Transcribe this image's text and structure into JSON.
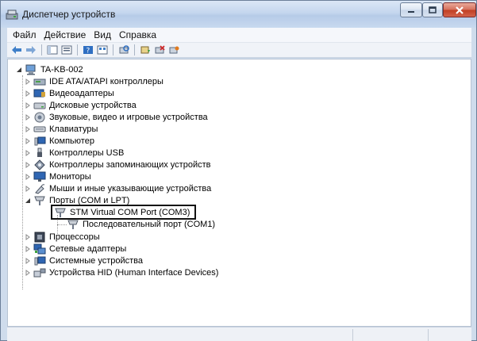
{
  "window": {
    "title": "Диспетчер устройств"
  },
  "menu": {
    "items": [
      "Файл",
      "Действие",
      "Вид",
      "Справка"
    ]
  },
  "toolbar": {
    "icons": [
      "back-icon",
      "forward-icon",
      "show-hide-console-tree-icon",
      "properties-icon",
      "help-icon",
      "view-icon",
      "scan-hardware-icon",
      "update-driver-icon",
      "disable-device-icon",
      "uninstall-device-icon"
    ]
  },
  "tree": {
    "root": "TA-KB-002",
    "categories": [
      {
        "label": "IDE ATA/ATAPI контроллеры",
        "icon": "ide-controller-icon"
      },
      {
        "label": "Видеоадаптеры",
        "icon": "display-adapter-icon"
      },
      {
        "label": "Дисковые устройства",
        "icon": "disk-drive-icon"
      },
      {
        "label": "Звуковые, видео и игровые устройства",
        "icon": "sound-icon"
      },
      {
        "label": "Клавиатуры",
        "icon": "keyboard-icon"
      },
      {
        "label": "Компьютер",
        "icon": "computer-icon"
      },
      {
        "label": "Контроллеры USB",
        "icon": "usb-icon"
      },
      {
        "label": "Контроллеры запоминающих устройств",
        "icon": "storage-controller-icon"
      },
      {
        "label": "Мониторы",
        "icon": "monitor-icon"
      },
      {
        "label": "Мыши и иные указывающие устройства",
        "icon": "mouse-icon"
      },
      {
        "label": "Порты (COM и LPT)",
        "icon": "port-icon",
        "expanded": true
      },
      {
        "label": "Процессоры",
        "icon": "processor-icon"
      },
      {
        "label": "Сетевые адаптеры",
        "icon": "network-adapter-icon"
      },
      {
        "label": "Системные устройства",
        "icon": "system-devices-icon"
      },
      {
        "label": "Устройства HID (Human Interface Devices)",
        "icon": "hid-icon"
      }
    ],
    "ports_children": [
      {
        "label": "STM Virtual COM Port (COM3)",
        "selected": true
      },
      {
        "label": "Последовательный порт (COM1)"
      }
    ]
  },
  "colors": {
    "window_frame": "#cfdcec",
    "close_button": "#c13f22",
    "highlight_border": "#111111"
  }
}
